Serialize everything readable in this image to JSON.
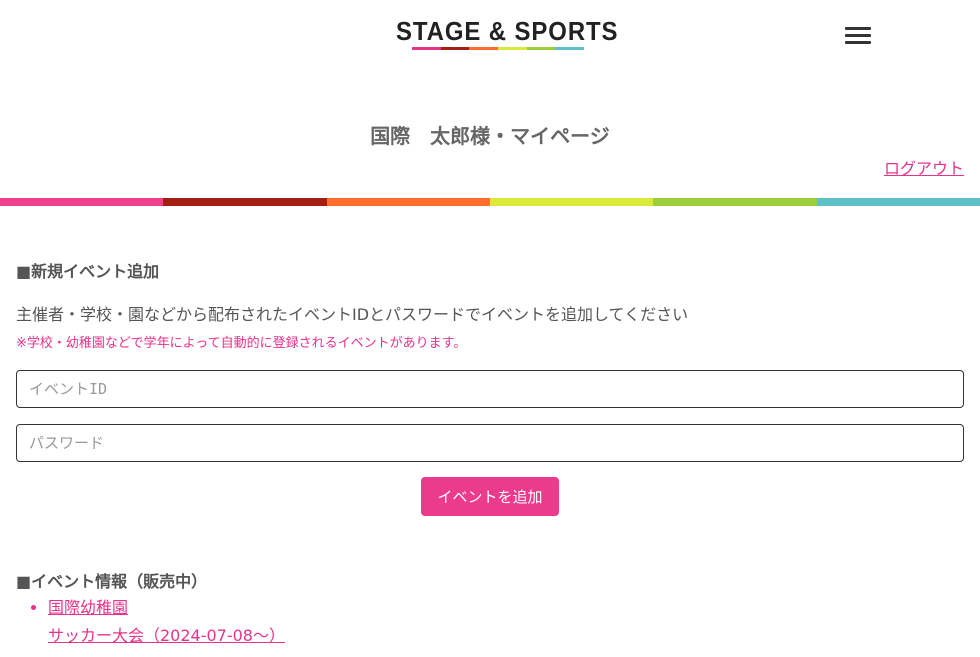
{
  "header": {
    "logo_text": "STAGE & SPORTS",
    "logo_bar_colors": [
      "#e8338a",
      "#a31f12",
      "#ff6f2c",
      "#d9ea3c",
      "#9ccf3a",
      "#5fc0c8"
    ],
    "menu_icon": "hamburger-menu-icon"
  },
  "page": {
    "title": "国際　太郎様・マイページ",
    "logout_label": "ログアウト",
    "stripe_colors": [
      "#f0418c",
      "#a31f12",
      "#ff6f2c",
      "#d9ea3c",
      "#9ccf3a",
      "#5fc0c8"
    ]
  },
  "new_event": {
    "heading": "■新規イベント追加",
    "description": "主催者・学校・園などから配布されたイベントIDとパスワードでイベントを追加してください",
    "note": "※学校・幼稚園などで学年によって自動的に登録されるイベントがあります。",
    "event_id_placeholder": "イベントID",
    "password_placeholder": "パスワード",
    "add_button_label": "イベントを追加"
  },
  "event_info": {
    "heading": "■イベント情報（販売中）",
    "items": [
      {
        "organization": "国際幼稚園",
        "event": "サッカー大会（2024-07-08～）"
      }
    ]
  },
  "colors": {
    "accent": "#e8338a",
    "button": "#ec3a8c",
    "text": "#555555"
  }
}
